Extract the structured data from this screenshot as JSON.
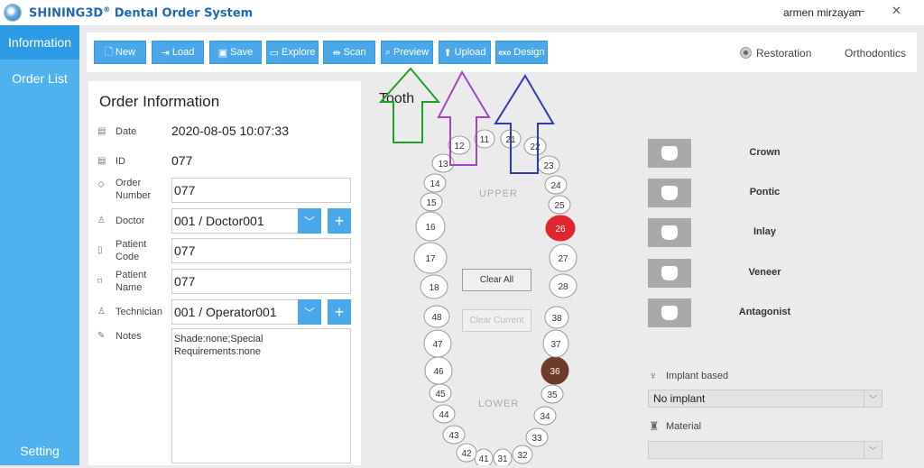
{
  "app": {
    "brand": "SHINING3D",
    "reg": "®",
    "title_rest": " Dental Order System",
    "user": "armen mirzayan",
    "minimize": "—",
    "close": "✕"
  },
  "sidebar": {
    "items": [
      {
        "label": "Information"
      },
      {
        "label": "Order List"
      }
    ],
    "setting": "Setting"
  },
  "toolbar": {
    "buttons": [
      {
        "label": "New",
        "icon": "file-icon"
      },
      {
        "label": "Load",
        "icon": "load-icon"
      },
      {
        "label": "Save",
        "icon": "save-icon"
      },
      {
        "label": "Explore",
        "icon": "folder-icon"
      },
      {
        "label": "Scan",
        "icon": "scan-icon"
      },
      {
        "label": "Preview",
        "icon": "preview-icon"
      },
      {
        "label": "Upload",
        "icon": "upload-icon"
      },
      {
        "label": "Design",
        "icon": "exo-icon",
        "icon_text": "exo"
      }
    ],
    "mode_restoration": "Restoration",
    "mode_orthodontics": "Orthodontics"
  },
  "order": {
    "title": "Order Information",
    "date_label": "Date",
    "date": "2020-08-05 10:07:33",
    "id_label": "ID",
    "id": "077",
    "order_number_label": "Order Number",
    "order_number": "077",
    "doctor_label": "Doctor",
    "doctor": "001 / Doctor001",
    "patient_code_label": "Patient Code",
    "patient_code": "077",
    "patient_name_label": "Patient Name",
    "patient_name": "077",
    "technician_label": "Technician",
    "technician": "001 / Operator001",
    "notes_label": "Notes",
    "notes": "Shade:none;Special Requirements:none"
  },
  "tooth": {
    "title": "Tooth",
    "upper_label": "UPPER",
    "lower_label": "LOWER",
    "clear_all": "Clear All",
    "clear_current": "Clear Current",
    "upper_left": [
      "11",
      "12",
      "13",
      "14",
      "15",
      "16",
      "17",
      "18"
    ],
    "upper_right": [
      "21",
      "22",
      "23",
      "24",
      "25",
      "26",
      "27",
      "28"
    ],
    "lower_left": [
      "41",
      "42",
      "43",
      "44",
      "45",
      "46",
      "47",
      "48"
    ],
    "lower_right": [
      "31",
      "32",
      "33",
      "34",
      "35",
      "36",
      "37",
      "38"
    ],
    "selected": [
      {
        "tooth": "26",
        "color": "#e0262c"
      },
      {
        "tooth": "36",
        "color": "#6e3a2a"
      }
    ]
  },
  "restoration_types": [
    "Crown",
    "Pontic",
    "Inlay",
    "Veneer",
    "Antagonist"
  ],
  "implant": {
    "label": "Implant based",
    "value": "No implant"
  },
  "material": {
    "label": "Material",
    "value": ""
  },
  "annotation_colors": {
    "preview_arrow": "#1aa323",
    "upload_arrow": "#a543c2",
    "design_arrow": "#2d3ab5"
  }
}
